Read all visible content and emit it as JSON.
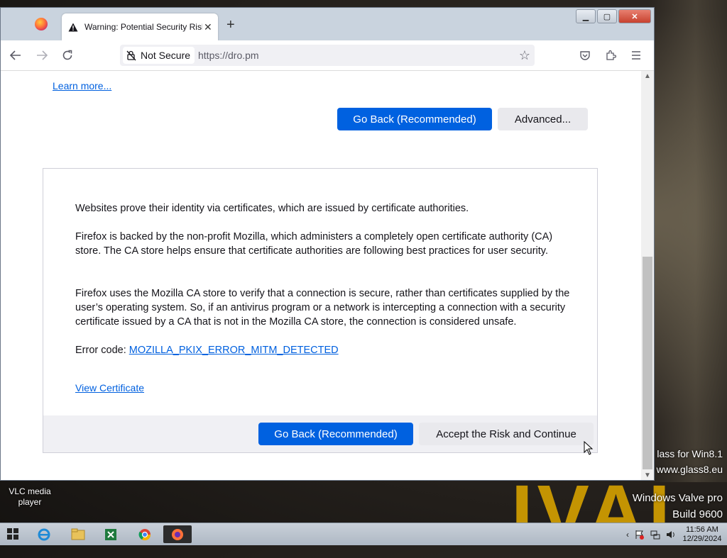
{
  "desktop": {
    "watermark_line1": "lass for Win8.1",
    "watermark_line2": "www.glass8.eu",
    "edition": "Windows Valve pro",
    "build": "Build 9600",
    "vlc_label": "VLC media player",
    "bg_text": "IVAI"
  },
  "tab": {
    "title": "Warning: Potential Security Risk Ahead",
    "close": "✕",
    "new_tab": "+"
  },
  "window_controls": {
    "minimize": "▁",
    "maximize": "▢",
    "close": "✕"
  },
  "navbar": {
    "security_label": "Not Secure",
    "url": "https://dro.pm"
  },
  "page": {
    "learn_more": "Learn more...",
    "go_back_top": "Go Back (Recommended)",
    "advanced": "Advanced...",
    "paragraph1": "Websites prove their identity via certificates, which are issued by certificate authorities.",
    "paragraph2": "Firefox is backed by the non-profit Mozilla, which administers a completely open certificate authority (CA) store. The CA store helps ensure that certificate authorities are following best practices for user security.",
    "paragraph3": "Firefox uses the Mozilla CA store to verify that a connection is secure, rather than certificates supplied by the user’s operating system. So, if an antivirus program or a network is intercepting a connection with a security certificate issued by a CA that is not in the Mozilla CA store, the connection is considered unsafe.",
    "error_code_label": "Error code: ",
    "error_code": "MOZILLA_PKIX_ERROR_MITM_DETECTED",
    "view_certificate": "View Certificate",
    "go_back_bottom": "Go Back (Recommended)",
    "accept_risk": "Accept the Risk and Continue"
  },
  "taskbar": {
    "time": "11:56 AM",
    "date": "12/29/2024"
  },
  "colors": {
    "primary_button": "#0061e0",
    "link": "#0060df",
    "secondary_button": "#e9e9ed"
  }
}
